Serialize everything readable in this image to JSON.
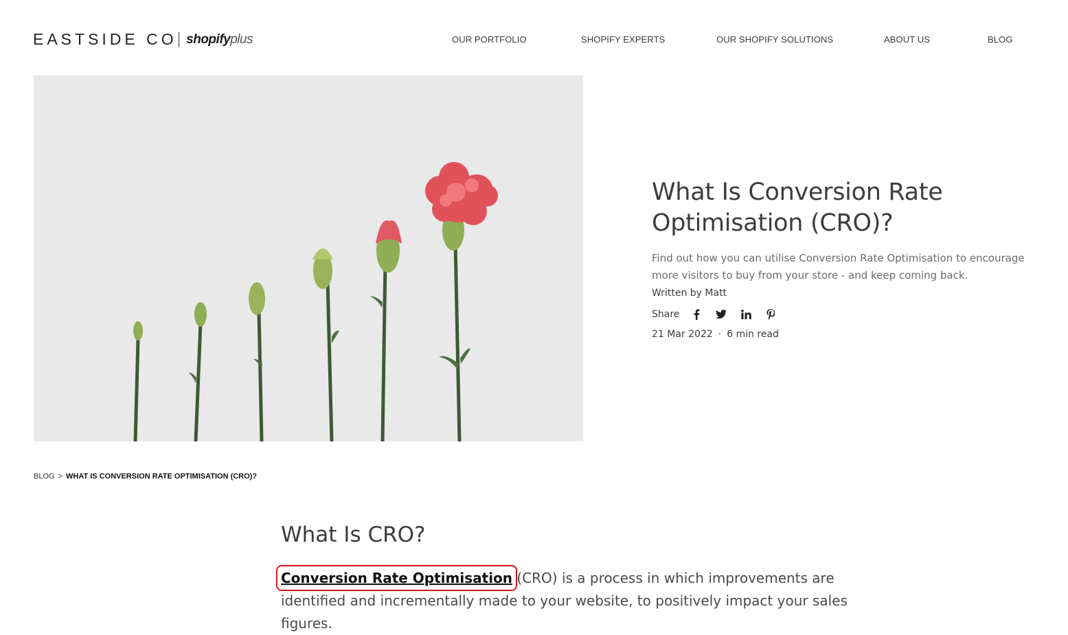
{
  "header": {
    "logo_brand": "EASTSIDE CO",
    "logo_shopify": "shopify",
    "logo_plus": "plus",
    "nav": [
      "OUR PORTFOLIO",
      "SHOPIFY EXPERTS",
      "OUR SHOPIFY SOLUTIONS",
      "ABOUT US",
      "BLOG"
    ]
  },
  "hero": {
    "title": "What Is Conversion Rate Optimisation (CRO)?",
    "subtitle": "Find out how you can utilise Conversion Rate Optimisation to encourage more visitors to buy from your store - and keep coming back.",
    "written_by_label": "Written by",
    "author": "Matt",
    "share_label": "Share",
    "share_icons": [
      "facebook-icon",
      "twitter-icon",
      "linkedin-icon",
      "pinterest-icon"
    ],
    "date": "21 Mar 2022",
    "separator": "·",
    "read_time": "6 min read",
    "image_description_icon": "carnation-flowers-image"
  },
  "breadcrumb": {
    "root": "BLOG",
    "separator": ">",
    "current": "WHAT IS CONVERSION RATE OPTIMISATION (CRO)?"
  },
  "article": {
    "heading": "What Is CRO?",
    "link_text": "Conversion Rate Optimisation",
    "body_rest": " (CRO) is a process in which improvements are identified and incrementally made to your website, to positively impact your sales figures."
  },
  "colors": {
    "highlight_box": "#e0121a",
    "image_bg": "#e9e9e9",
    "stem": "#3c5a36",
    "flower": "#e0525a"
  }
}
